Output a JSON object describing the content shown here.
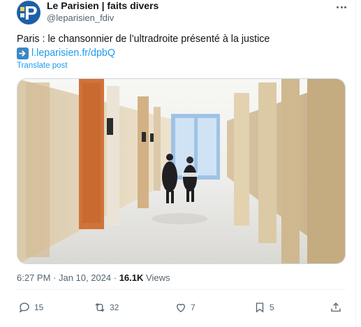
{
  "author": {
    "name": "Le Parisien | faits divers",
    "handle": "@leparisien_fdiv",
    "avatar_letter": "P",
    "avatar_color": "#1d5fa8"
  },
  "tweet": {
    "text": "Paris : le chansonnier de l’ultradroite présenté à la justice",
    "link_icon": "right-arrow-emoji-icon",
    "link": "l.leparisien.fr/dpbQ",
    "translate_label": "Translate post"
  },
  "meta": {
    "time": "6:27 PM · Jan 10, 2024 · ",
    "views_count": "16.1K",
    "views_label": " Views"
  },
  "actions": {
    "replies": "15",
    "reposts": "32",
    "likes": "7",
    "bookmarks": "5"
  },
  "colors": {
    "accent": "#1d9bf0",
    "text": "#0f1419",
    "muted": "#536471"
  }
}
